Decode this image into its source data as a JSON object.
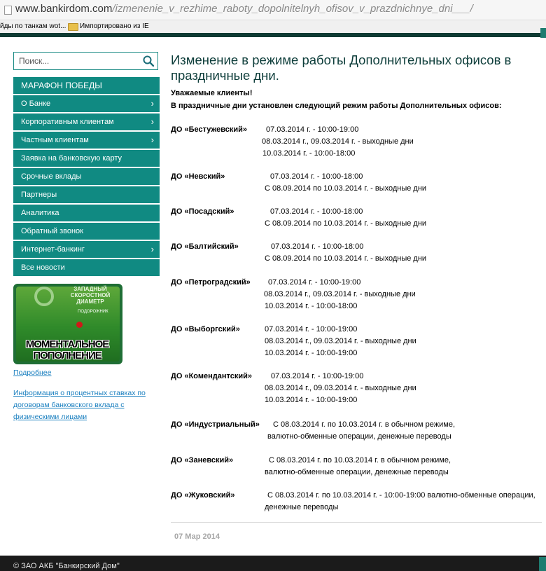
{
  "browser": {
    "url_host": "www.bankirdom.com",
    "url_path": "/izmenenie_v_rezhime_raboty_dopolnitelnyh_ofisov_v_prazdnichnye_dni___/",
    "bookmarks": [
      "йды по танкам wot...",
      "Импортировано из IE"
    ]
  },
  "search": {
    "placeholder": "Поиск..."
  },
  "menu": [
    {
      "label": "МАРАФОН ПОБЕДЫ",
      "arrow": ""
    },
    {
      "label": "О Банке",
      "arrow": "›"
    },
    {
      "label": "Корпоративным клиентам",
      "arrow": "›"
    },
    {
      "label": "Частным клиентам",
      "arrow": "›"
    },
    {
      "label": "Заявка на банковскую карту",
      "arrow": ""
    },
    {
      "label": "Срочные вклады",
      "arrow": ""
    },
    {
      "label": "Партнеры",
      "arrow": ""
    },
    {
      "label": "Аналитика",
      "arrow": ""
    },
    {
      "label": "Обратный звонок",
      "arrow": ""
    },
    {
      "label": "Интернет-банкинг",
      "arrow": "›"
    },
    {
      "label": "Все новости",
      "arrow": ""
    }
  ],
  "banner": {
    "tag": "ЗАПАДНЫЙ СКОРОСТНОЙ ДИАМЕТР",
    "small": "ПОДОРОЖНИК",
    "line1": "МОМЕНТАЛЬНОЕ",
    "line2": "ПОПОЛНЕНИЕ"
  },
  "links": {
    "more": "Подробнее",
    "rates": "Информация о процентных ставках по договорам банковского вклада с физическими лицами"
  },
  "article": {
    "title": "Изменение в режиме работы Дополнительных офисов в праздничные дни.",
    "greeting": "Уважаемые клиенты!",
    "intro": "В праздничные дни установлен следующий режим работы Дополнительных офисов:",
    "offices": [
      {
        "name": "ДО «Бестужевский»",
        "lines": [
          "07.03.2014 г. - 10:00-19:00",
          "08.03.2014 г., 09.03.2014 г. - выходные дни",
          "10.03.2014 г. - 10:00-18:00"
        ]
      },
      {
        "name": "ДО  «Невский»",
        "lines": [
          "07.03.2014 г. - 10:00-18:00",
          "С 08.09.2014 по 10.03.2014 г. - выходные дни"
        ]
      },
      {
        "name": "ДО «Посадский»",
        "lines": [
          "07.03.2014 г. - 10:00-18:00",
          "С 08.09.2014 по 10.03.2014 г. - выходные дни"
        ]
      },
      {
        "name": "ДО «Балтийский»",
        "lines": [
          "07.03.2014 г. - 10:00-18:00",
          "С 08.09.2014 по 10.03.2014 г. - выходные дни"
        ]
      },
      {
        "name": "ДО «Петроградский»",
        "lines": [
          "07.03.2014 г. - 10:00-19:00",
          "08.03.2014 г., 09.03.2014 г. - выходные дни",
          "10.03.2014 г. - 10:00-18:00"
        ]
      },
      {
        "name": "ДО «Выборгский»",
        "lines": [
          "07.03.2014 г. - 10:00-19:00",
          "08.03.2014 г., 09.03.2014 г. - выходные дни",
          "10.03.2014 г. - 10:00-19:00"
        ]
      },
      {
        "name": "ДО «Комендантский»",
        "lines": [
          "07.03.2014 г. - 10:00-19:00",
          "08.03.2014 г., 09.03.2014 г. - выходные дни",
          "10.03.2014 г. - 10:00-19:00"
        ]
      },
      {
        "name": "ДО «Индустриальный»",
        "lines": [
          "С 08.03.2014 г. по 10.03.2014 г. в обычном режиме,",
          "валютно-обменные операции, денежные переводы"
        ]
      },
      {
        "name": "ДО «Заневский»",
        "lines": [
          "С 08.03.2014 г. по 10.03.2014 г. в обычном режиме,",
          "валютно-обменные операции, денежные переводы"
        ]
      },
      {
        "name": "ДО «Жуковский»",
        "lines": [
          "С 08.03.2014 г. по 10.03.2014 г. - 10:00-19:00 валютно-обменные операции,",
          "денежные переводы"
        ]
      }
    ],
    "date": "07 Мар 2014"
  },
  "footer": {
    "copyright": "© ЗАО АКБ \"Банкирский Дом\""
  },
  "colors": {
    "menu_bg": "#108a82",
    "title": "#0d3d3a",
    "link": "#1a7fbf",
    "footer": "#1b1b1b"
  }
}
